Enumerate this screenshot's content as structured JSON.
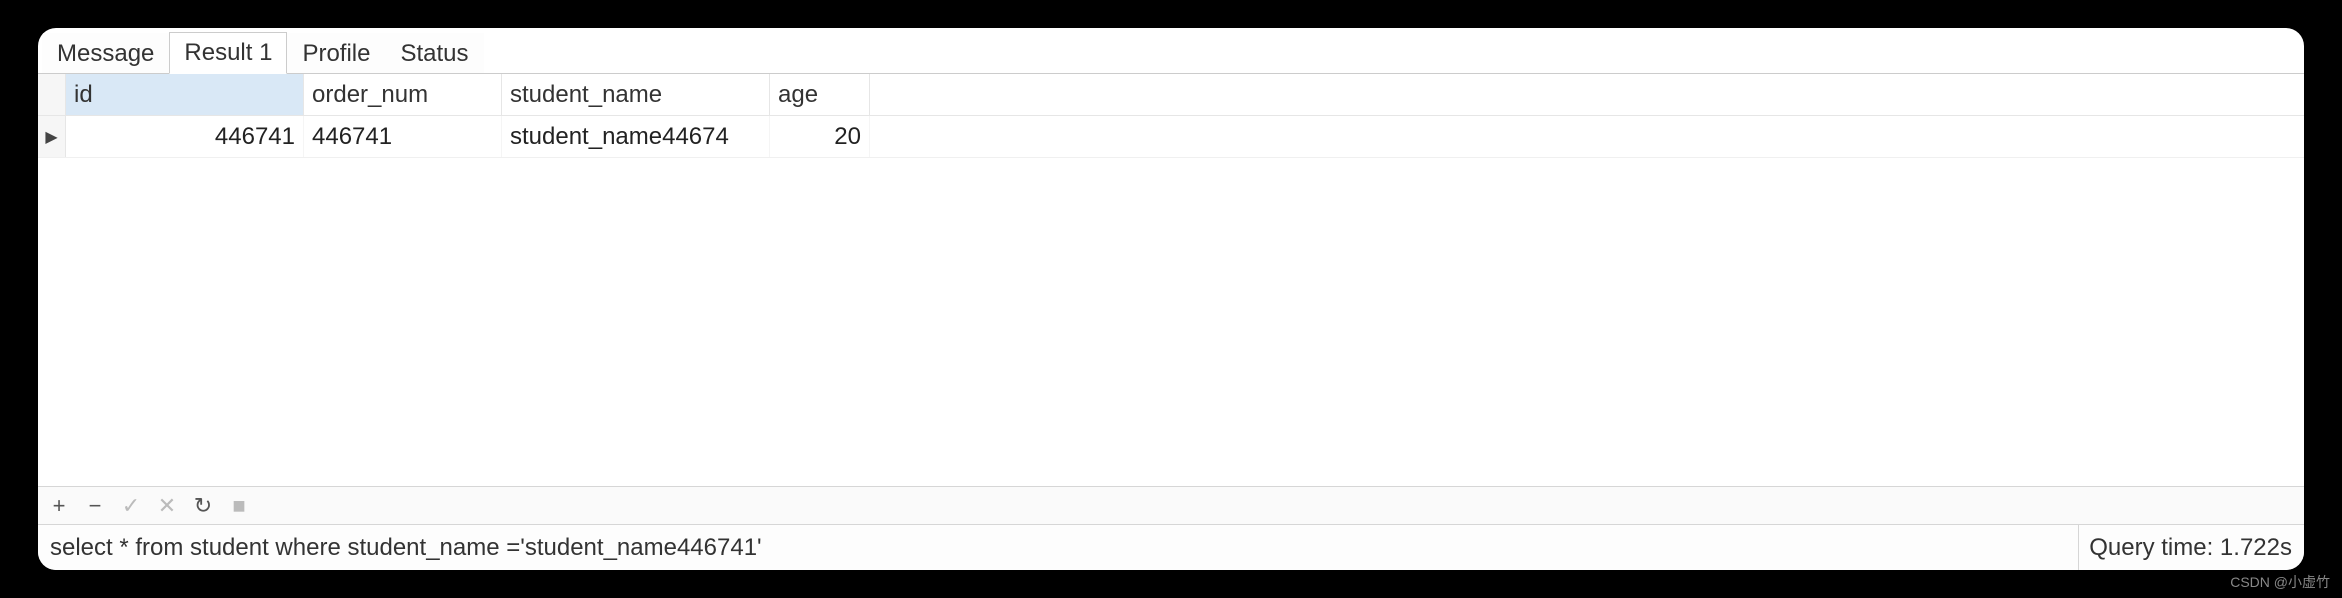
{
  "tabs": [
    "Message",
    "Result 1",
    "Profile",
    "Status"
  ],
  "active_tab_index": 1,
  "columns": [
    "id",
    "order_num",
    "student_name",
    "age"
  ],
  "rows": [
    {
      "id": "446741",
      "order_num": "446741",
      "student_name": "student_name44674",
      "age": "20"
    }
  ],
  "toolbar": {
    "add": "+",
    "remove": "−",
    "check": "✓",
    "cancel": "✕",
    "refresh": "↻",
    "stop": "■"
  },
  "status": {
    "query": "select * from student where student_name ='student_name446741'",
    "query_time_label": "Query time: 1.722s"
  },
  "watermark": "CSDN @小虚竹"
}
